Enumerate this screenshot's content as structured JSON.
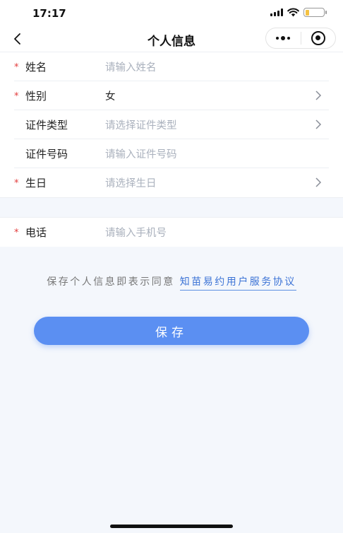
{
  "status_bar": {
    "time": "17:17"
  },
  "nav": {
    "title": "个人信息"
  },
  "form_group_1": [
    {
      "required": true,
      "label": "姓名",
      "value": "请输入姓名",
      "filled": false,
      "arrow": false
    },
    {
      "required": true,
      "label": "性别",
      "value": "女",
      "filled": true,
      "arrow": true
    },
    {
      "required": false,
      "label": "证件类型",
      "value": "请选择证件类型",
      "filled": false,
      "arrow": true
    },
    {
      "required": false,
      "label": "证件号码",
      "value": "请输入证件号码",
      "filled": false,
      "arrow": false
    },
    {
      "required": true,
      "label": "生日",
      "value": "请选择生日",
      "filled": false,
      "arrow": true
    }
  ],
  "form_group_2": [
    {
      "required": true,
      "label": "电话",
      "value": "请输入手机号",
      "filled": false,
      "arrow": false
    }
  ],
  "required_mark": "*",
  "agreement": {
    "prefix": "保存个人信息即表示同意",
    "link": "知苗易约用户服务协议"
  },
  "save_button": {
    "label": "保存"
  },
  "colors": {
    "accent": "#5b8ff2",
    "required": "#e23b3b",
    "placeholder": "#aab1bd",
    "link": "#3d74d6"
  }
}
